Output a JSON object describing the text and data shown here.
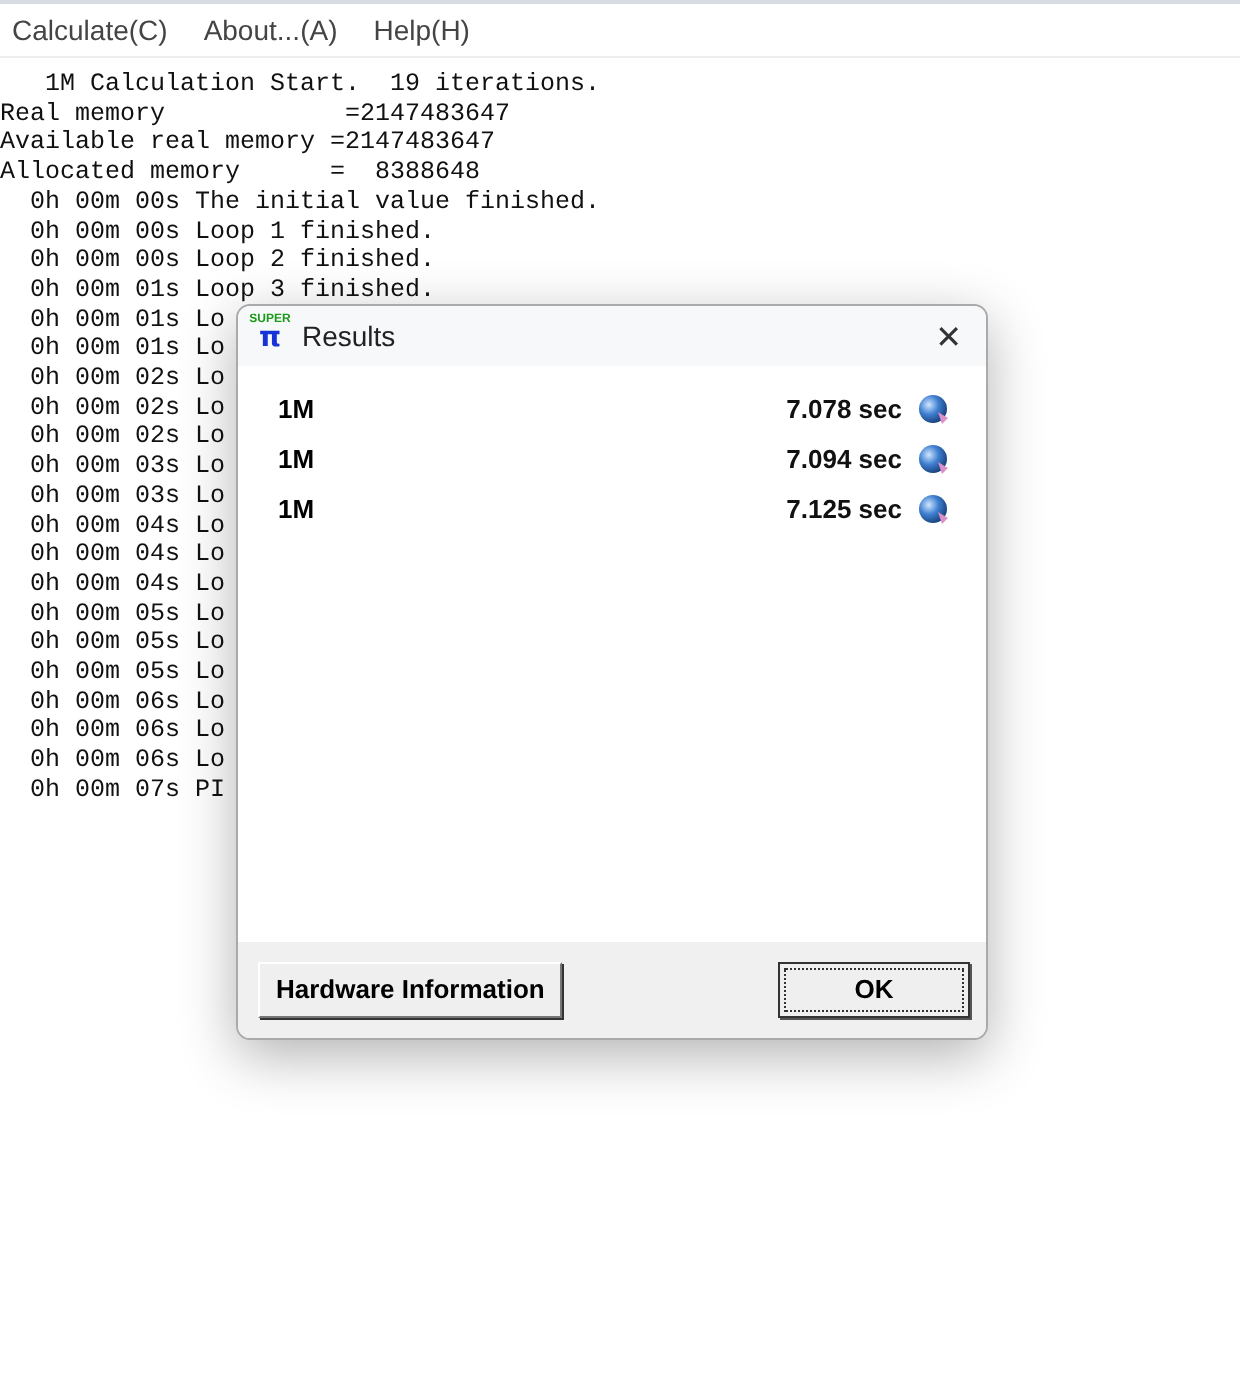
{
  "menu": [
    "Calculate(C)",
    "About...(A)",
    "Help(H)"
  ],
  "log": [
    "   1M Calculation Start.  19 iterations.",
    "Real memory            =2147483647",
    "Available real memory =2147483647",
    "Allocated memory      =  8388648",
    "  0h 00m 00s The initial value finished.",
    "  0h 00m 00s Loop 1 finished.",
    "  0h 00m 00s Loop 2 finished.",
    "  0h 00m 01s Loop 3 finished.",
    "  0h 00m 01s Lo",
    "  0h 00m 01s Lo",
    "  0h 00m 02s Lo",
    "  0h 00m 02s Lo",
    "  0h 00m 02s Lo",
    "  0h 00m 03s Lo",
    "  0h 00m 03s Lo",
    "  0h 00m 04s Lo",
    "  0h 00m 04s Lo",
    "  0h 00m 04s Lo",
    "  0h 00m 05s Lo",
    "  0h 00m 05s Lo",
    "  0h 00m 05s Lo",
    "  0h 00m 06s Lo",
    "  0h 00m 06s Lo",
    "  0h 00m 06s Lo",
    "  0h 00m 07s PI"
  ],
  "dialog": {
    "logo": {
      "top": "SUPER",
      "bottom": "π"
    },
    "title": "Results",
    "close": "✕",
    "results": [
      {
        "size": "1M",
        "time": "7.078 sec"
      },
      {
        "size": "1M",
        "time": "7.094 sec"
      },
      {
        "size": "1M",
        "time": "7.125 sec"
      }
    ],
    "buttons": [
      {
        "label": "Hardware Information",
        "focused": false
      },
      {
        "label": "OK",
        "focused": true
      }
    ]
  }
}
